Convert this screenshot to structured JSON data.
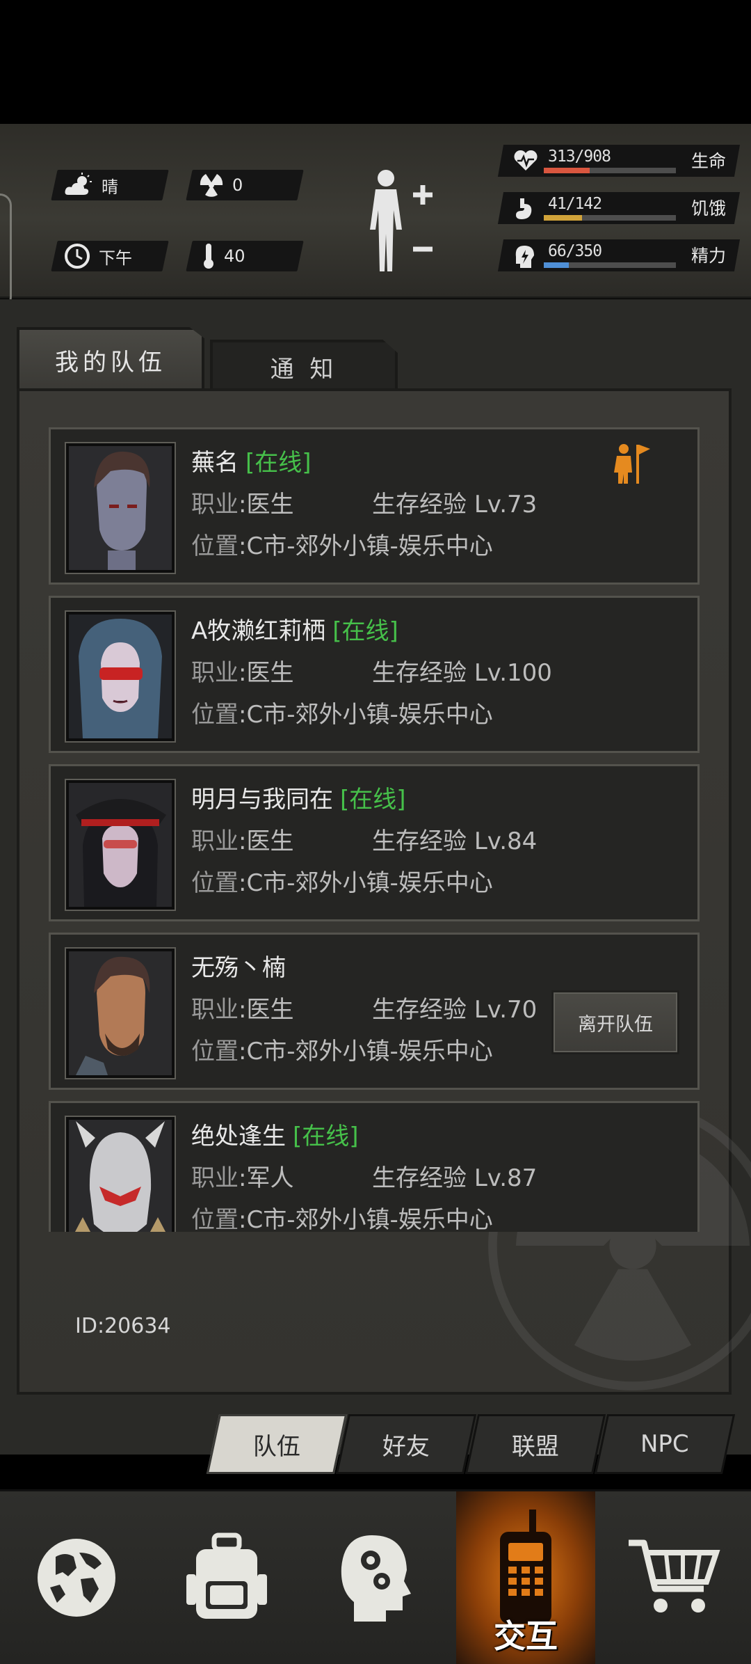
{
  "hud": {
    "weather": {
      "label": "晴",
      "icon": "cloud-sun-icon"
    },
    "radiation": {
      "value": "0",
      "icon": "radiation-icon"
    },
    "time": {
      "label": "下午",
      "icon": "clock-icon"
    },
    "temperature": {
      "value": "40",
      "icon": "thermometer-icon"
    },
    "stats": [
      {
        "icon": "heart-icon",
        "value": "313/908",
        "label": "生命",
        "fraction": 0.345,
        "color": "#d9563f"
      },
      {
        "icon": "stomach-icon",
        "value": "41/142",
        "label": "饥饿",
        "fraction": 0.289,
        "color": "#d1a33a"
      },
      {
        "icon": "energy-head-icon",
        "value": "66/350",
        "label": "精力",
        "fraction": 0.189,
        "color": "#4f8fd6"
      }
    ]
  },
  "tabs": {
    "my_team": "我的队伍",
    "notice": "通 知"
  },
  "labels": {
    "job": "职业",
    "exp": "生存经验",
    "loc": "位置",
    "online": "[在线]"
  },
  "members": [
    {
      "name": "蕪名",
      "online": true,
      "job": "医生",
      "level": "Lv.73",
      "location": "C市-郊外小镇-娱乐中心",
      "portrait": "male-portrait-icon",
      "leader": true
    },
    {
      "name": "A牧濑红莉栖",
      "online": true,
      "job": "医生",
      "level": "Lv.100",
      "location": "C市-郊外小镇-娱乐中心",
      "portrait": "female-goggles-portrait-icon",
      "leader": false
    },
    {
      "name": "明月与我同在",
      "online": true,
      "job": "医生",
      "level": "Lv.84",
      "location": "C市-郊外小镇-娱乐中心",
      "portrait": "officer-cap-portrait-icon",
      "leader": false
    },
    {
      "name": "无殇丶楠",
      "online": false,
      "job": "医生",
      "level": "Lv.70",
      "location": "C市-郊外小镇-娱乐中心",
      "portrait": "bearded-portrait-icon",
      "leader": false,
      "action": "离开队伍"
    },
    {
      "name": "绝处逢生",
      "online": true,
      "job": "军人",
      "level": "Lv.87",
      "location": "C市-郊外小镇-娱乐中心",
      "portrait": "helmet-portrait-icon",
      "leader": false
    }
  ],
  "id_text": "ID:20634",
  "subtabs": [
    "队伍",
    "好友",
    "联盟",
    "NPC"
  ],
  "nav": {
    "active_label": "交互",
    "items": [
      "globe-icon",
      "backpack-icon",
      "head-gears-icon",
      "radio-icon",
      "cart-icon"
    ]
  }
}
